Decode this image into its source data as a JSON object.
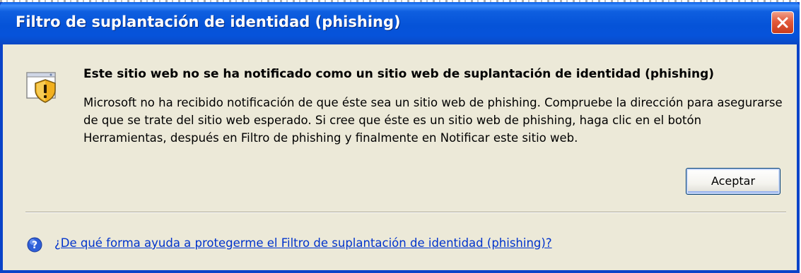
{
  "window": {
    "title": "Filtro de suplantación de identidad (phishing)",
    "accent": "#0a43c8",
    "background": "#ece9d8"
  },
  "dialog": {
    "heading": "Este sitio web no se ha notificado como un sitio web de suplantación de identidad (phishing)",
    "body": "Microsoft no ha recibido notificación de que éste sea un sitio web de phishing. Compruebe la dirección para asegurarse de que se trate del sitio web esperado. Si cree que éste es un sitio web de phishing, haga clic en el botón Herramientas, después en Filtro de phishing y finalmente en Notificar este sitio web.",
    "ok_label": "Aceptar",
    "help_link": "¿De qué forma ayuda a protegerme el Filtro de suplantación de identidad (phishing)?",
    "link_color": "#0033cc"
  },
  "icons": {
    "dialog_icon": "warning-shield-icon",
    "help_icon": "question-icon",
    "close_icon": "close-icon"
  }
}
